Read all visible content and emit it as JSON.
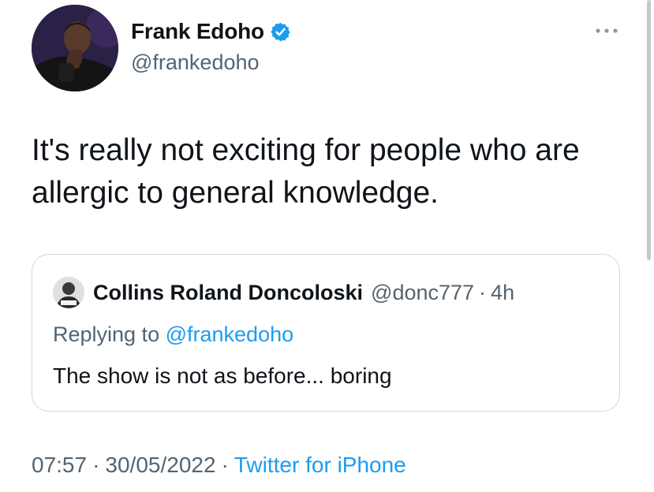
{
  "author": {
    "display_name": "Frank Edoho",
    "handle": "@frankedoho",
    "verified": true,
    "avatar_icon": "profile-photo"
  },
  "more_icon": "ellipsis-icon",
  "tweet": {
    "text": "It's really not exciting for people who are allergic to general knowledge."
  },
  "quoted_tweet": {
    "display_name": "Collins Roland Doncoloski",
    "handle": "@donc777",
    "separator": "·",
    "time": "4h",
    "replying_prefix": "Replying to",
    "replying_to": "@frankedoho",
    "text": "The show is not as before... boring"
  },
  "meta": {
    "time": "07:57",
    "separator": "·",
    "date": "30/05/2022",
    "source": "Twitter for iPhone"
  },
  "colors": {
    "text": "#0f1419",
    "secondary": "#536471",
    "accent": "#1d9bf0",
    "border": "#cfd9de"
  }
}
